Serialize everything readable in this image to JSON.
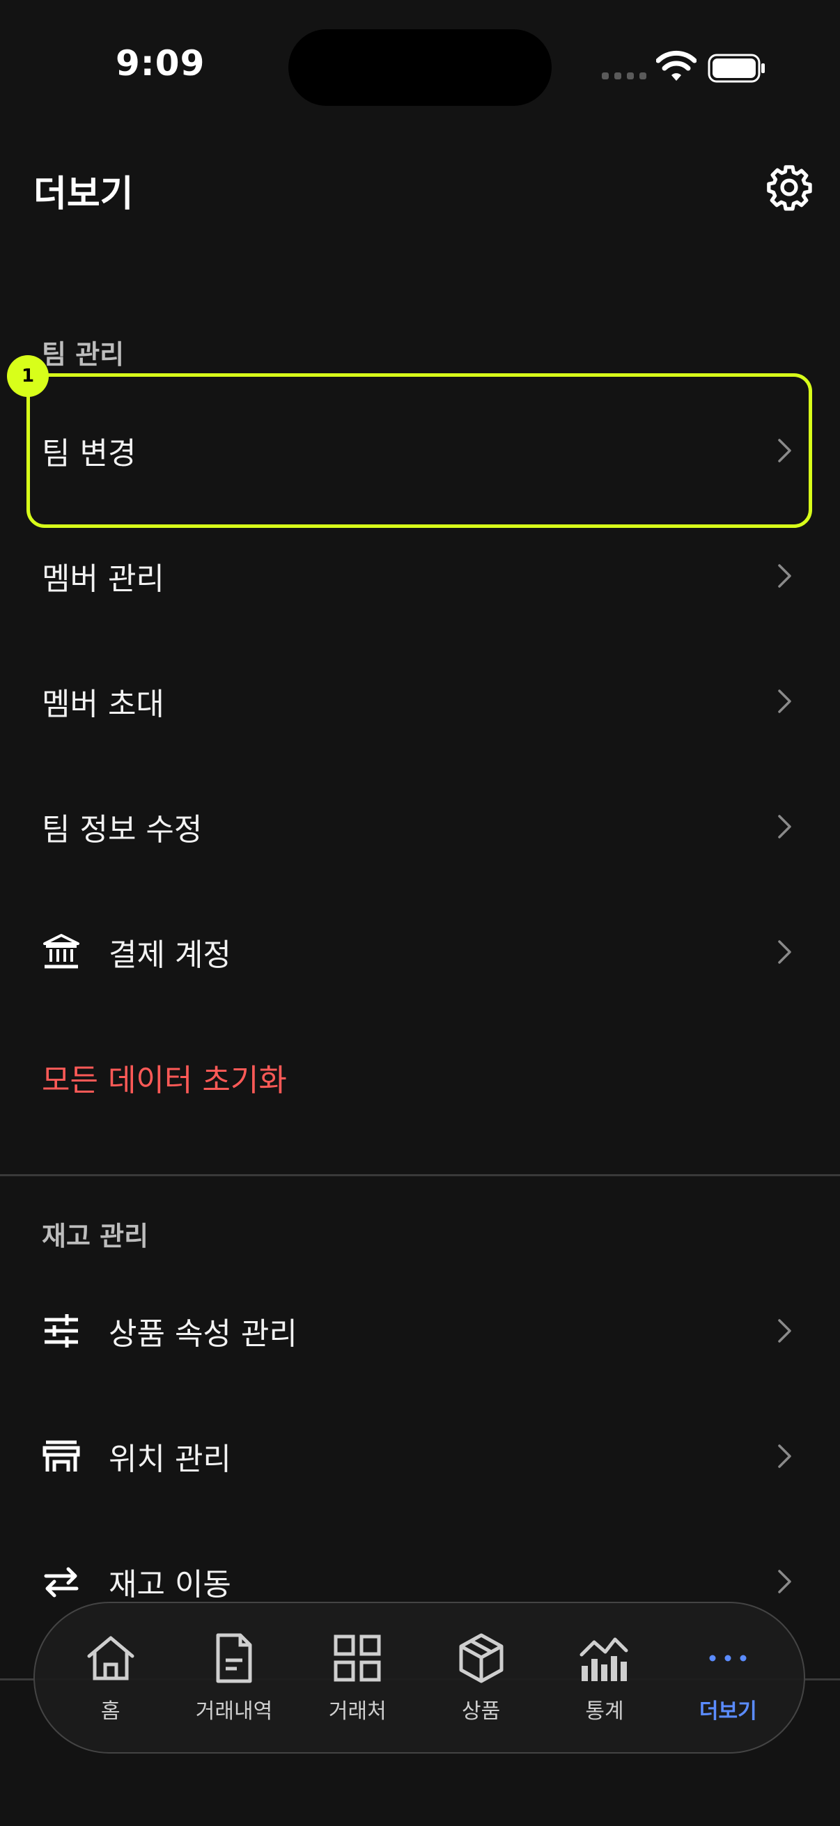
{
  "status_bar": {
    "time": "9:09"
  },
  "header": {
    "title": "더보기",
    "settings_icon": "gear-icon"
  },
  "team_section": {
    "label": "팀 관리",
    "items": [
      {
        "label": "팀 변경",
        "icon": ""
      },
      {
        "label": "멤버 관리",
        "icon": ""
      },
      {
        "label": "멤버 초대",
        "icon": ""
      },
      {
        "label": "팀 정보 수정",
        "icon": ""
      },
      {
        "label": "결제 계정",
        "icon": "bank-icon"
      }
    ],
    "danger_action": "모든 데이터 초기화"
  },
  "inventory_section": {
    "label": "재고 관리",
    "items": [
      {
        "label": "상품 속성 관리",
        "icon": "sliders-icon"
      },
      {
        "label": "위치 관리",
        "icon": "store-icon"
      },
      {
        "label": "재고 이동",
        "icon": "transfer-arrows-icon"
      }
    ]
  },
  "highlight_marker": {
    "number": "1"
  },
  "tab_bar": {
    "active_color": "#5b8cff",
    "tabs": [
      {
        "label": "홈",
        "icon": "home-icon"
      },
      {
        "label": "거래내역",
        "icon": "document-icon"
      },
      {
        "label": "거래처",
        "icon": "grid-icon"
      },
      {
        "label": "상품",
        "icon": "box-icon"
      },
      {
        "label": "통계",
        "icon": "chart-icon"
      },
      {
        "label": "더보기",
        "icon": "more-dots-icon",
        "active": true
      }
    ]
  },
  "colors": {
    "background": "#131313",
    "accent_highlight": "#d8ff1a",
    "danger": "#ff5a57"
  }
}
